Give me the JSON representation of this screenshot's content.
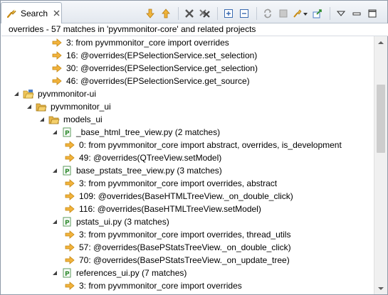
{
  "tab": {
    "label": "Search",
    "icon": "search-flashlight-icon",
    "close_icon": "close-x-icon"
  },
  "toolbar": {
    "buttons": [
      "next-match-arrow-down-icon",
      "previous-match-arrow-up-icon",
      "remove-selected-matches-icon",
      "remove-all-matches-icon",
      "expand-all-icon",
      "collapse-all-icon",
      "run-current-search-again-icon",
      "cancel-search-icon",
      "search-history-icon",
      "pin-search-view-icon",
      "view-menu-icon",
      "minimize-icon",
      "maximize-icon"
    ]
  },
  "summary": "overrides - 57 matches in 'pyvmmonitor-core' and related projects",
  "colors": {
    "arrow_match": "#e8a318",
    "folder": "#e6b64a",
    "project": "#4a7bc4",
    "module_green": "#3a9a3a",
    "scrollbar_track": "#f0f0f0"
  },
  "tree": [
    {
      "indent": 3,
      "type": "match",
      "text": "3: from pyvmmonitor_core import overrides"
    },
    {
      "indent": 3,
      "type": "match",
      "text": "16: @overrides(EPSelectionService.set_selection)"
    },
    {
      "indent": 3,
      "type": "match",
      "text": "30: @overrides(EPSelectionService.get_selection)"
    },
    {
      "indent": 3,
      "type": "match",
      "text": "46: @overrides(EPSelectionService.get_source)"
    },
    {
      "indent": 0,
      "type": "project",
      "text": "pyvmmonitor-ui",
      "expanded": true
    },
    {
      "indent": 1,
      "type": "folder",
      "text": "pyvmmonitor_ui",
      "expanded": true
    },
    {
      "indent": 2,
      "type": "folder",
      "text": "models_ui",
      "expanded": true
    },
    {
      "indent": 3,
      "type": "module",
      "text": "_base_html_tree_view.py (2 matches)",
      "expanded": true
    },
    {
      "indent": 4,
      "type": "match",
      "text": "0: from pyvmmonitor_core import abstract, overrides, is_development"
    },
    {
      "indent": 4,
      "type": "match",
      "text": "49: @overrides(QTreeView.setModel)"
    },
    {
      "indent": 3,
      "type": "module",
      "text": "base_pstats_tree_view.py (3 matches)",
      "expanded": true
    },
    {
      "indent": 4,
      "type": "match",
      "text": "3: from pyvmmonitor_core import overrides, abstract"
    },
    {
      "indent": 4,
      "type": "match",
      "text": "109: @overrides(BaseHTMLTreeView._on_double_click)"
    },
    {
      "indent": 4,
      "type": "match",
      "text": "116: @overrides(BaseHTMLTreeView.setModel)"
    },
    {
      "indent": 3,
      "type": "module",
      "text": "pstats_ui.py (3 matches)",
      "expanded": true
    },
    {
      "indent": 4,
      "type": "match",
      "text": "3: from pyvmmonitor_core import overrides, thread_utils"
    },
    {
      "indent": 4,
      "type": "match",
      "text": "57: @overrides(BasePStatsTreeView._on_double_click)"
    },
    {
      "indent": 4,
      "type": "match",
      "text": "70: @overrides(BasePStatsTreeView._on_update_tree)"
    },
    {
      "indent": 3,
      "type": "module",
      "text": "references_ui.py (7 matches)",
      "expanded": true
    },
    {
      "indent": 4,
      "type": "match",
      "text": "3: from pyvmmonitor_core import overrides"
    }
  ]
}
